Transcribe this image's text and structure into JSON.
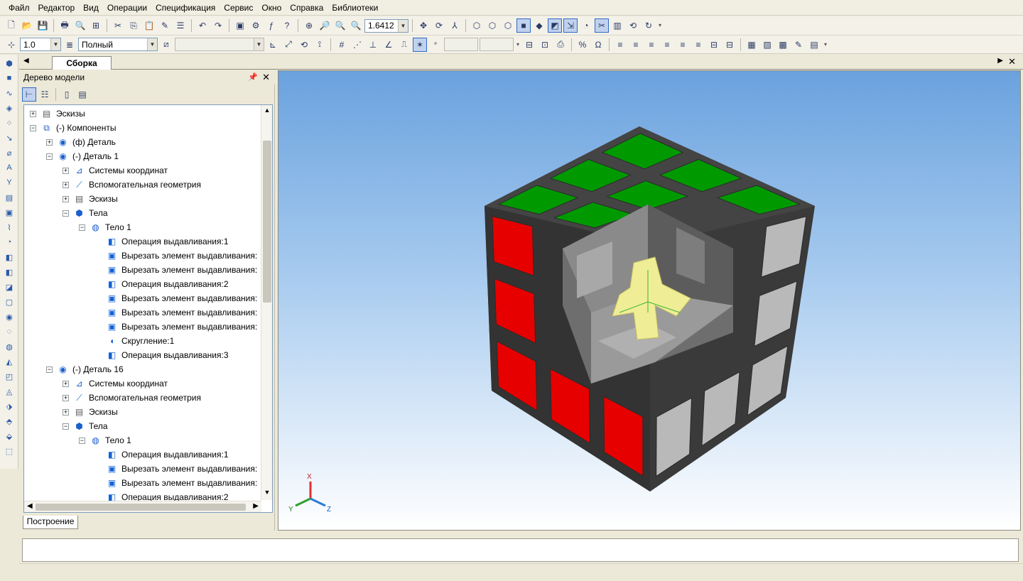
{
  "menu": [
    "Файл",
    "Редактор",
    "Вид",
    "Операции",
    "Спецификация",
    "Сервис",
    "Окно",
    "Справка",
    "Библиотеки"
  ],
  "toolbar": {
    "zoom_value": "1.6412",
    "line_width": "1.0",
    "view_mode": "Полный"
  },
  "document_tab": "Сборка",
  "tree_panel": {
    "title": "Дерево модели",
    "bottom_tab": "Построение",
    "rows": [
      {
        "indent": 0,
        "exp": "+",
        "icon": "folder",
        "label": "Эскизы"
      },
      {
        "indent": 0,
        "exp": "−",
        "icon": "components",
        "label": "(-) Компоненты"
      },
      {
        "indent": 1,
        "exp": "+",
        "icon": "part",
        "label": "(ф) Деталь"
      },
      {
        "indent": 1,
        "exp": "−",
        "icon": "part",
        "label": "(-) Деталь 1"
      },
      {
        "indent": 2,
        "exp": "+",
        "icon": "coords",
        "label": "Системы координат"
      },
      {
        "indent": 2,
        "exp": "+",
        "icon": "aux",
        "label": "Вспомогательная геометрия"
      },
      {
        "indent": 2,
        "exp": "+",
        "icon": "folder",
        "label": "Эскизы"
      },
      {
        "indent": 2,
        "exp": "−",
        "icon": "bodies",
        "label": "Тела"
      },
      {
        "indent": 3,
        "exp": "−",
        "icon": "body",
        "label": "Тело 1"
      },
      {
        "indent": 4,
        "exp": "",
        "icon": "extrude",
        "label": "Операция выдавливания:1"
      },
      {
        "indent": 4,
        "exp": "",
        "icon": "cut",
        "label": "Вырезать элемент выдавливания:"
      },
      {
        "indent": 4,
        "exp": "",
        "icon": "cut",
        "label": "Вырезать элемент выдавливания:"
      },
      {
        "indent": 4,
        "exp": "",
        "icon": "extrude",
        "label": "Операция выдавливания:2"
      },
      {
        "indent": 4,
        "exp": "",
        "icon": "cut",
        "label": "Вырезать элемент выдавливания:"
      },
      {
        "indent": 4,
        "exp": "",
        "icon": "cut",
        "label": "Вырезать элемент выдавливания:"
      },
      {
        "indent": 4,
        "exp": "",
        "icon": "cut",
        "label": "Вырезать элемент выдавливания:"
      },
      {
        "indent": 4,
        "exp": "",
        "icon": "fillet",
        "label": "Скругление:1"
      },
      {
        "indent": 4,
        "exp": "",
        "icon": "extrude",
        "label": "Операция выдавливания:3"
      },
      {
        "indent": 1,
        "exp": "−",
        "icon": "part",
        "label": "(-) Деталь 16"
      },
      {
        "indent": 2,
        "exp": "+",
        "icon": "coords",
        "label": "Системы координат"
      },
      {
        "indent": 2,
        "exp": "+",
        "icon": "aux",
        "label": "Вспомогательная геометрия"
      },
      {
        "indent": 2,
        "exp": "+",
        "icon": "folder",
        "label": "Эскизы"
      },
      {
        "indent": 2,
        "exp": "−",
        "icon": "bodies",
        "label": "Тела"
      },
      {
        "indent": 3,
        "exp": "−",
        "icon": "body",
        "label": "Тело 1"
      },
      {
        "indent": 4,
        "exp": "",
        "icon": "extrude",
        "label": "Операция выдавливания:1"
      },
      {
        "indent": 4,
        "exp": "",
        "icon": "cut",
        "label": "Вырезать элемент выдавливания:"
      },
      {
        "indent": 4,
        "exp": "",
        "icon": "cut",
        "label": "Вырезать элемент выдавливания:"
      },
      {
        "indent": 4,
        "exp": "",
        "icon": "extrude",
        "label": "Операция выдавливания:2"
      }
    ]
  },
  "axes": {
    "x": "X",
    "y": "Y",
    "z": "Z"
  },
  "colors": {
    "top": "#009a00",
    "left": "#e60000",
    "right": "#b9b9b9",
    "cavity": "#7a7a7a",
    "core": "#f0ef9a"
  }
}
